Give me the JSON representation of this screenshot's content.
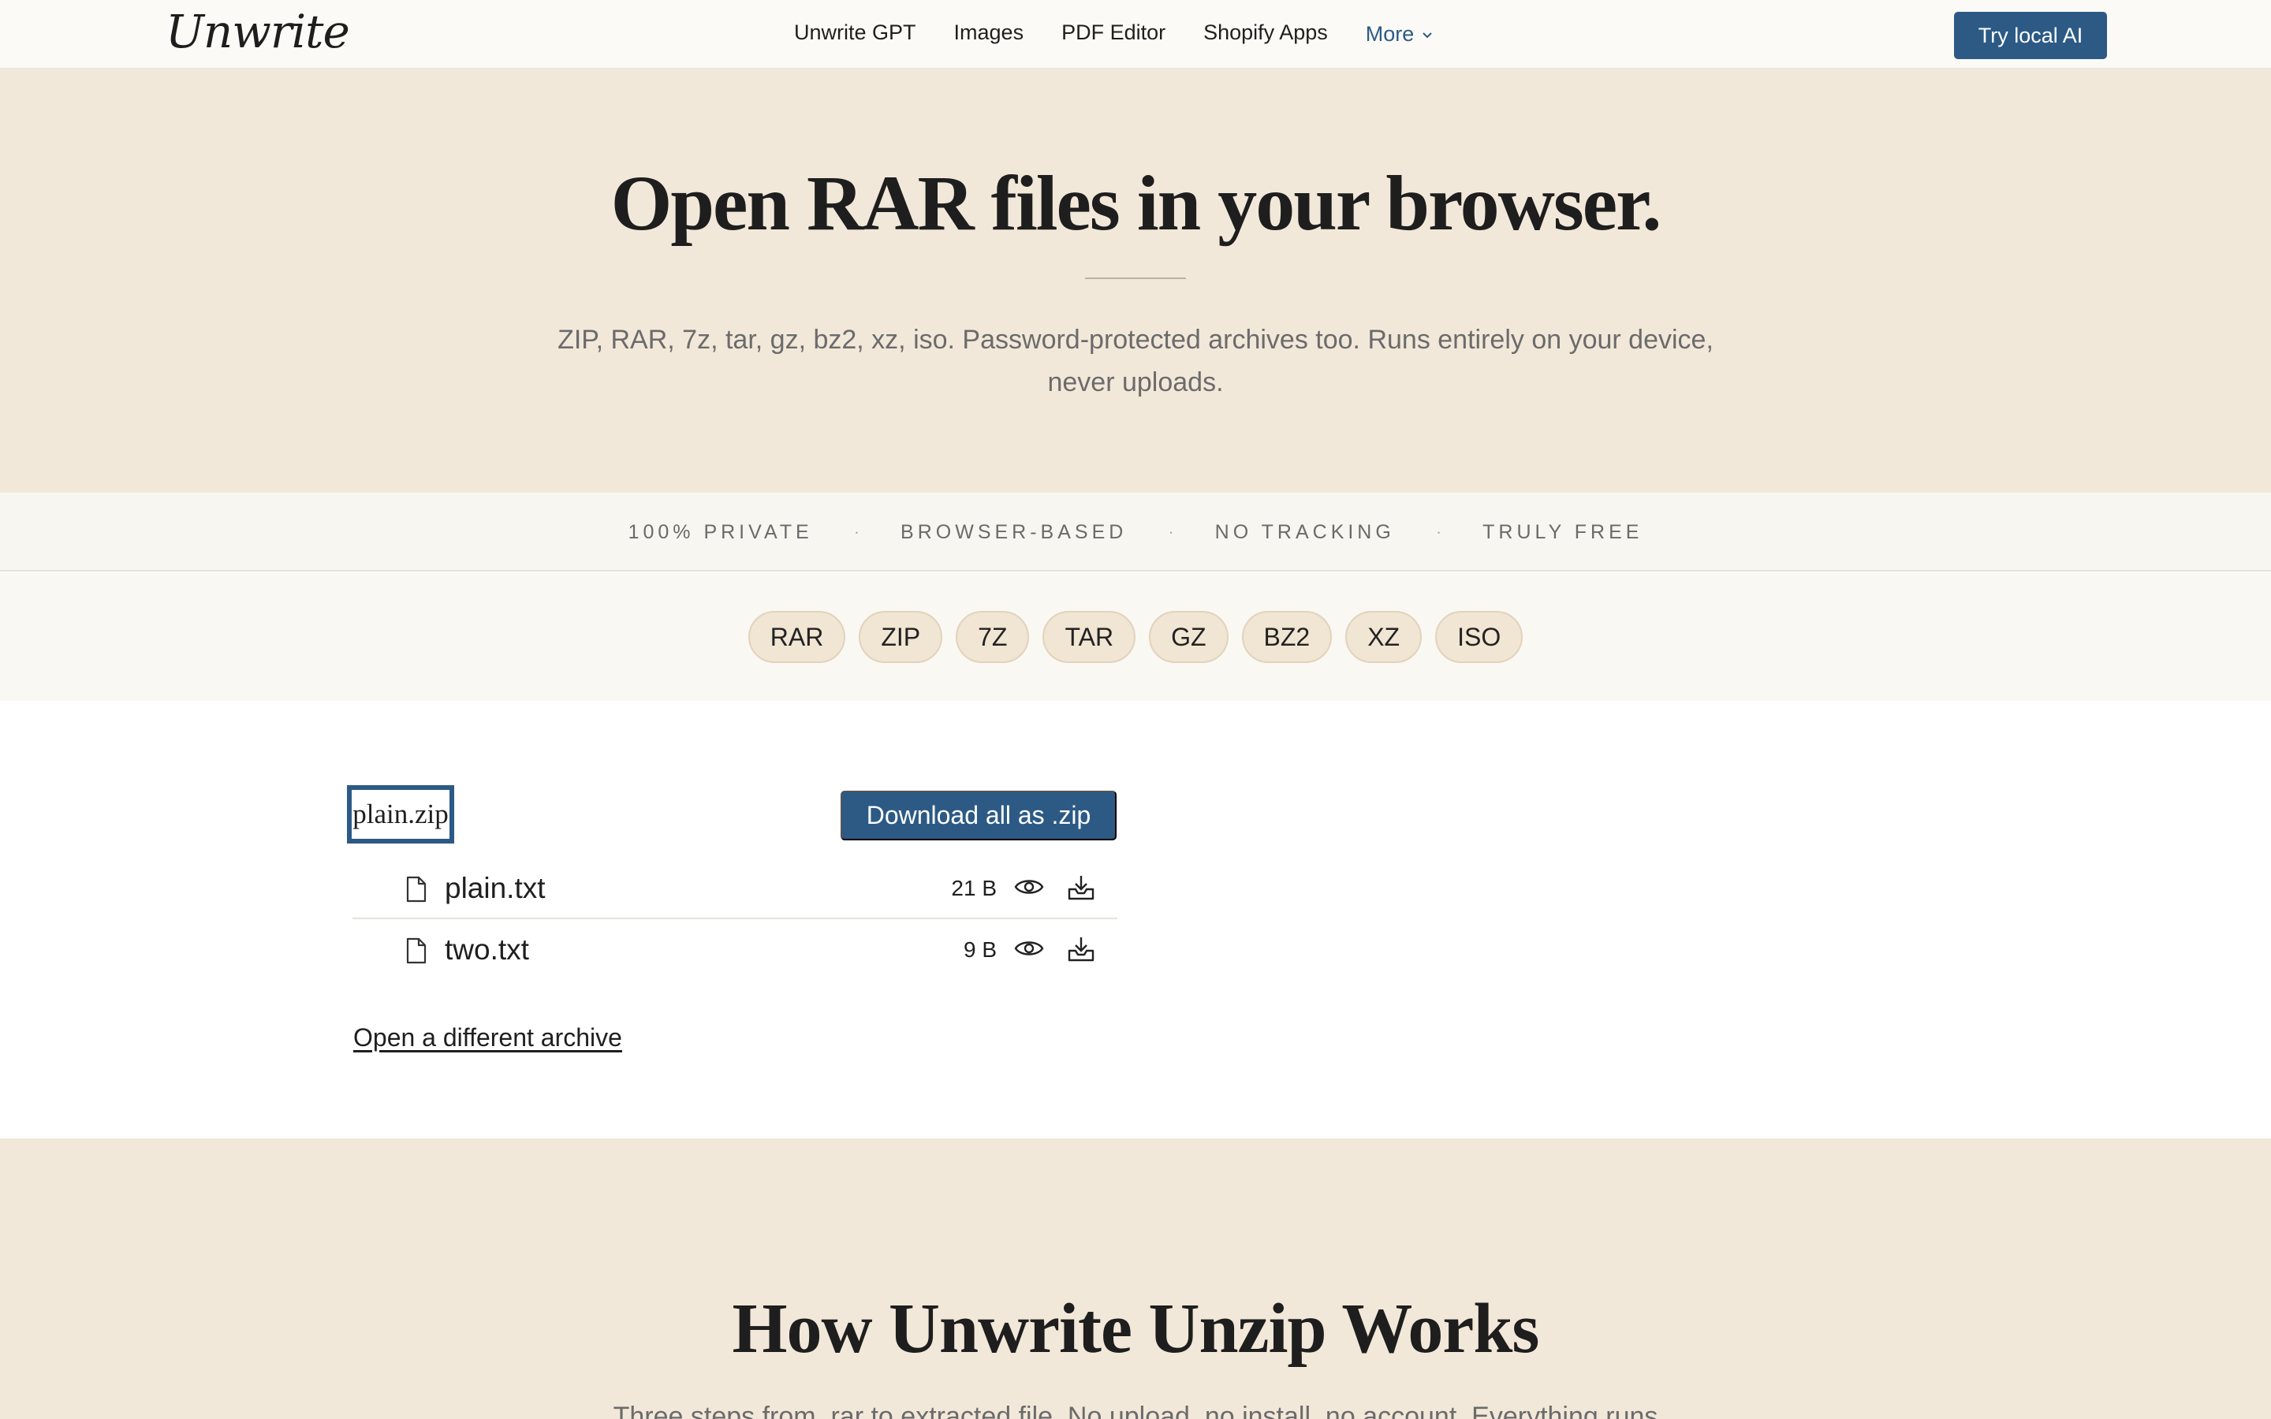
{
  "nav": {
    "logo": "Unwrite",
    "links": [
      "Unwrite GPT",
      "Images",
      "PDF Editor",
      "Shopify Apps"
    ],
    "more_label": "More",
    "cta_label": "Try local AI"
  },
  "hero": {
    "title": "Open RAR files in your browser.",
    "subtitle": "ZIP, RAR, 7z, tar, gz, bz2, xz, iso. Password-protected archives too. Runs entirely on your device, never uploads."
  },
  "features": [
    "100% PRIVATE",
    "BROWSER-BASED",
    "NO TRACKING",
    "TRULY FREE"
  ],
  "formats": [
    "RAR",
    "ZIP",
    "7Z",
    "TAR",
    "GZ",
    "BZ2",
    "XZ",
    "ISO"
  ],
  "archive": {
    "name": "plain.zip",
    "download_all_label": "Download all as .zip",
    "files": [
      {
        "name": "plain.txt",
        "size": "21 B"
      },
      {
        "name": "two.txt",
        "size": "9 B"
      }
    ],
    "open_different_label": "Open a different archive"
  },
  "how": {
    "title": "How Unwrite Unzip Works",
    "subtitle": "Three steps from .rar to extracted file. No upload, no install, no account. Everything runs"
  },
  "colors": {
    "accent": "#2c5a85",
    "hero_bg": "#f2e8d9",
    "pill_bg": "#f1e5d3"
  }
}
